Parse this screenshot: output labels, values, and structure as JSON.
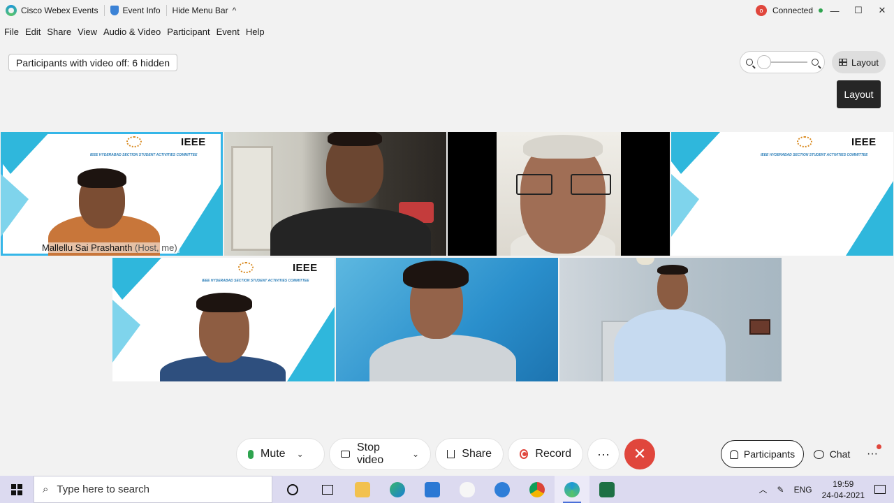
{
  "titlebar": {
    "app_name": "Cisco Webex Events",
    "event_info": "Event Info",
    "hide_menu": "Hide Menu Bar",
    "hide_menu_chevron": "^",
    "status": "Connected",
    "status_color": "#2ea44f",
    "window_controls": [
      "—",
      "☐",
      "✕"
    ]
  },
  "menu": [
    "File",
    "Edit",
    "Share",
    "View",
    "Audio & Video",
    "Participant",
    "Event",
    "Help"
  ],
  "video_off_label": "Participants with video off: 6 hidden",
  "layout_button": "Layout",
  "layout_tooltip": "Layout",
  "banner": {
    "logo_text": "IEEE",
    "subtitle": "IEEE HYDERABAD SECTION STUDENT ACTIVITIES COMMITTEE"
  },
  "participants": [
    {
      "name": "Mallellu Sai Prashanth",
      "role": "(Host, me)"
    }
  ],
  "controls": {
    "mute": "Mute",
    "stop_video": "Stop video",
    "share": "Share",
    "record": "Record",
    "more": "···",
    "end": "✕",
    "participants": "Participants",
    "chat": "Chat"
  },
  "accent_color": "#35b6e8",
  "end_call_color": "#e0463c",
  "taskbar": {
    "search_placeholder": "Type here to search",
    "language": "ENG",
    "time": "19:59",
    "date": "24-04-2021"
  }
}
